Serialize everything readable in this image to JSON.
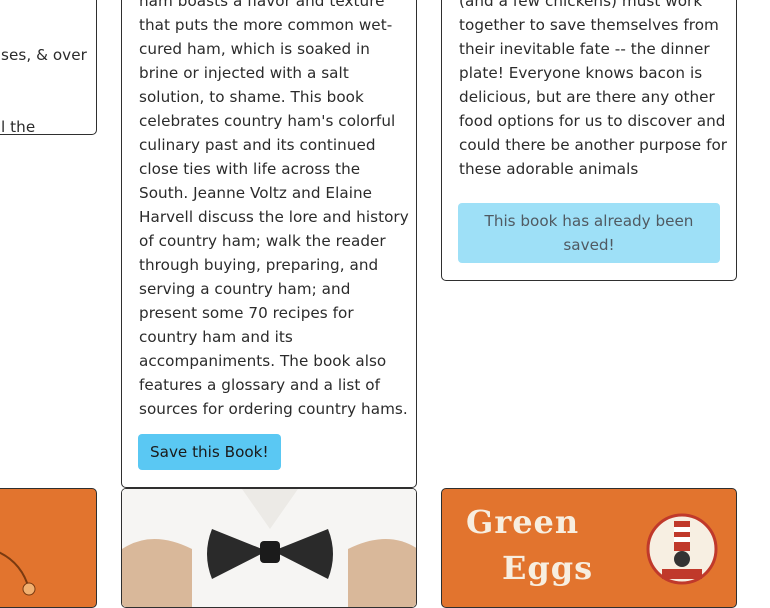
{
  "cards": {
    "left": {
      "lines": [
        "ses, & over",
        "l the"
      ]
    },
    "middle": {
      "lines": [
        "ham boasts a flavor and texture",
        "that puts the more common wet-",
        "cured ham, which is soaked in",
        "brine or injected with a salt",
        "solution, to shame. This book",
        "celebrates country ham's colorful",
        "culinary past and its continued",
        "close ties with life across the",
        "South. Jeanne Voltz and Elaine",
        "Harvell discuss the lore and history",
        "of country ham; walk the reader",
        "through buying, preparing, and",
        "serving a country ham; and",
        "present some 70 recipes for",
        "country ham and its",
        "accompaniments. The book also",
        "features a glossary and a list of",
        "sources for ordering country hams."
      ],
      "button_label": "Save this Book!"
    },
    "right": {
      "lines": [
        "(and a few chickens) must work",
        "together to save themselves from",
        "their inevitable fate -- the dinner",
        "plate! Everyone knows bacon is",
        "delicious, but are there any other",
        "food options for us to discover and",
        "could there be another purpose for",
        "these adorable animals"
      ],
      "saved_label_line1": "This book has already been",
      "saved_label_line2": "saved!"
    }
  },
  "covers": {
    "green_eggs": {
      "title_line1": "Green",
      "title_line2": "Eggs"
    }
  },
  "colors": {
    "save_button": "#5ac8f3",
    "saved_badge": "#9ee0f7",
    "cover_orange": "#e2742e"
  }
}
